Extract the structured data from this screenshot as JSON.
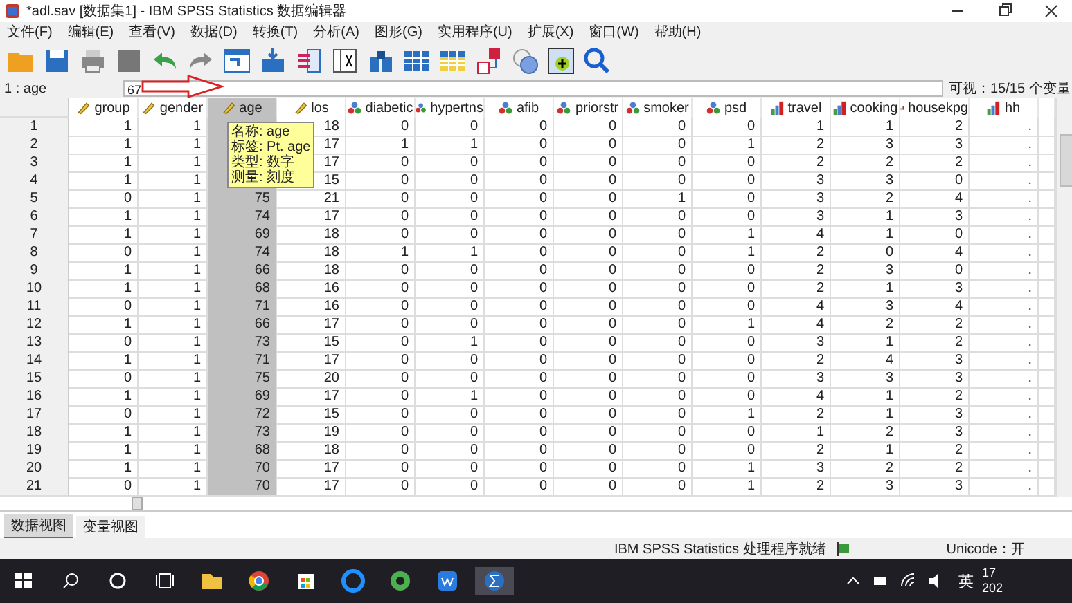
{
  "window": {
    "title": "*adl.sav [数据集1] - IBM SPSS Statistics 数据编辑器"
  },
  "menu": [
    "文件(F)",
    "编辑(E)",
    "查看(V)",
    "数据(D)",
    "转换(T)",
    "分析(A)",
    "图形(G)",
    "实用程序(U)",
    "扩展(X)",
    "窗口(W)",
    "帮助(H)"
  ],
  "cell_editor": {
    "reference": "1 : age",
    "value": "67",
    "visible_count": "可视：15/15 个变量"
  },
  "columns": [
    {
      "name": "group",
      "kind": "scale",
      "selected": false
    },
    {
      "name": "gender",
      "kind": "scale",
      "selected": false
    },
    {
      "name": "age",
      "kind": "scale",
      "selected": true
    },
    {
      "name": "los",
      "kind": "scale",
      "selected": false
    },
    {
      "name": "diabetic",
      "kind": "nominal",
      "selected": false
    },
    {
      "name": "hypertns",
      "kind": "nominal",
      "selected": false
    },
    {
      "name": "afib",
      "kind": "nominal",
      "selected": false
    },
    {
      "name": "priorstr",
      "kind": "nominal",
      "selected": false
    },
    {
      "name": "smoker",
      "kind": "nominal",
      "selected": false
    },
    {
      "name": "psd",
      "kind": "nominal",
      "selected": false
    },
    {
      "name": "travel",
      "kind": "ordinal",
      "selected": false
    },
    {
      "name": "cooking",
      "kind": "ordinal",
      "selected": false
    },
    {
      "name": "housekpg",
      "kind": "ordinal",
      "selected": false
    },
    {
      "name": "hh",
      "kind": "ordinal",
      "selected": false
    }
  ],
  "rows": [
    {
      "n": "1",
      "cells": [
        "1",
        "1",
        null,
        "18",
        "0",
        "0",
        "0",
        "0",
        "0",
        "0",
        "1",
        "1",
        "2",
        "."
      ]
    },
    {
      "n": "2",
      "cells": [
        "1",
        "1",
        null,
        "17",
        "1",
        "1",
        "0",
        "0",
        "0",
        "1",
        "2",
        "3",
        "3",
        "."
      ]
    },
    {
      "n": "3",
      "cells": [
        "1",
        "1",
        null,
        "17",
        "0",
        "0",
        "0",
        "0",
        "0",
        "0",
        "2",
        "2",
        "2",
        "."
      ]
    },
    {
      "n": "4",
      "cells": [
        "1",
        "1",
        null,
        "15",
        "0",
        "0",
        "0",
        "0",
        "0",
        "0",
        "3",
        "3",
        "0",
        "."
      ]
    },
    {
      "n": "5",
      "cells": [
        "0",
        "1",
        "75",
        "21",
        "0",
        "0",
        "0",
        "0",
        "1",
        "0",
        "3",
        "2",
        "4",
        "."
      ]
    },
    {
      "n": "6",
      "cells": [
        "1",
        "1",
        "74",
        "17",
        "0",
        "0",
        "0",
        "0",
        "0",
        "0",
        "3",
        "1",
        "3",
        "."
      ]
    },
    {
      "n": "7",
      "cells": [
        "1",
        "1",
        "69",
        "18",
        "0",
        "0",
        "0",
        "0",
        "0",
        "1",
        "4",
        "1",
        "0",
        "."
      ]
    },
    {
      "n": "8",
      "cells": [
        "0",
        "1",
        "74",
        "18",
        "1",
        "1",
        "0",
        "0",
        "0",
        "1",
        "2",
        "0",
        "4",
        "."
      ]
    },
    {
      "n": "9",
      "cells": [
        "1",
        "1",
        "66",
        "18",
        "0",
        "0",
        "0",
        "0",
        "0",
        "0",
        "2",
        "3",
        "0",
        "."
      ]
    },
    {
      "n": "10",
      "cells": [
        "1",
        "1",
        "68",
        "16",
        "0",
        "0",
        "0",
        "0",
        "0",
        "0",
        "2",
        "1",
        "3",
        "."
      ]
    },
    {
      "n": "11",
      "cells": [
        "0",
        "1",
        "71",
        "16",
        "0",
        "0",
        "0",
        "0",
        "0",
        "0",
        "4",
        "3",
        "4",
        "."
      ]
    },
    {
      "n": "12",
      "cells": [
        "1",
        "1",
        "66",
        "17",
        "0",
        "0",
        "0",
        "0",
        "0",
        "1",
        "4",
        "2",
        "2",
        "."
      ]
    },
    {
      "n": "13",
      "cells": [
        "0",
        "1",
        "73",
        "15",
        "0",
        "1",
        "0",
        "0",
        "0",
        "0",
        "3",
        "1",
        "2",
        "."
      ]
    },
    {
      "n": "14",
      "cells": [
        "1",
        "1",
        "71",
        "17",
        "0",
        "0",
        "0",
        "0",
        "0",
        "0",
        "2",
        "4",
        "3",
        "."
      ]
    },
    {
      "n": "15",
      "cells": [
        "0",
        "1",
        "75",
        "20",
        "0",
        "0",
        "0",
        "0",
        "0",
        "0",
        "3",
        "3",
        "3",
        "."
      ]
    },
    {
      "n": "16",
      "cells": [
        "1",
        "1",
        "69",
        "17",
        "0",
        "1",
        "0",
        "0",
        "0",
        "0",
        "4",
        "1",
        "2",
        "."
      ]
    },
    {
      "n": "17",
      "cells": [
        "0",
        "1",
        "72",
        "15",
        "0",
        "0",
        "0",
        "0",
        "0",
        "1",
        "2",
        "1",
        "3",
        "."
      ]
    },
    {
      "n": "18",
      "cells": [
        "1",
        "1",
        "73",
        "19",
        "0",
        "0",
        "0",
        "0",
        "0",
        "0",
        "1",
        "2",
        "3",
        "."
      ]
    },
    {
      "n": "19",
      "cells": [
        "1",
        "1",
        "68",
        "18",
        "0",
        "0",
        "0",
        "0",
        "0",
        "0",
        "2",
        "1",
        "2",
        "."
      ]
    },
    {
      "n": "20",
      "cells": [
        "1",
        "1",
        "70",
        "17",
        "0",
        "0",
        "0",
        "0",
        "0",
        "1",
        "3",
        "2",
        "2",
        "."
      ]
    },
    {
      "n": "21",
      "cells": [
        "0",
        "1",
        "70",
        "17",
        "0",
        "0",
        "0",
        "0",
        "0",
        "1",
        "2",
        "3",
        "3",
        "."
      ]
    }
  ],
  "tooltip": [
    "名称: age",
    "标签: Pt. age",
    "类型: 数字",
    "测量: 刻度"
  ],
  "view_tabs": [
    {
      "label": "数据视图",
      "selected": true
    },
    {
      "label": "变量视图",
      "selected": false
    }
  ],
  "status_bar": {
    "processor": "IBM SPSS Statistics 处理程序就绪",
    "unicode": "Unicode：开"
  },
  "taskbar": {
    "input_method": "英",
    "clock": [
      "17",
      "202"
    ]
  }
}
